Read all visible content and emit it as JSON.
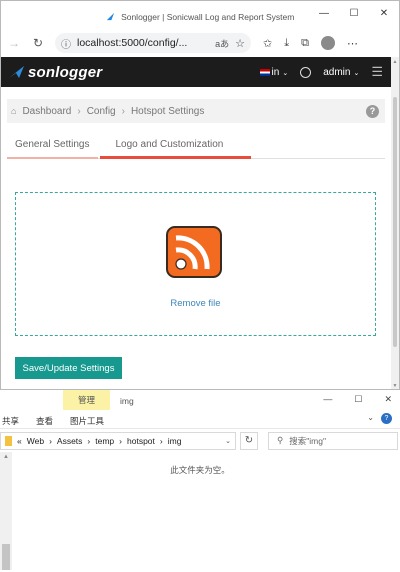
{
  "browser": {
    "title": "Sonlogger | Sonicwall Log and Report System",
    "url": "localhost:5000/config/...",
    "reader_label": "aあ"
  },
  "app": {
    "brand": "sonlogger",
    "language": "in",
    "user": "admin"
  },
  "breadcrumb": {
    "items": [
      "Dashboard",
      "Config",
      "Hotspot Settings"
    ],
    "help": "?"
  },
  "tabs": {
    "general": "General Settings",
    "logo": "Logo and Customization"
  },
  "dropzone": {
    "remove_label": "Remove file"
  },
  "save_button": "Save/Update Settings",
  "explorer": {
    "tools_tab": "管理",
    "folder": "img",
    "ribbon_tabs": [
      "共享",
      "查看",
      "图片工具"
    ],
    "path": [
      "«",
      "Web",
      "Assets",
      "temp",
      "hotspot",
      "img"
    ],
    "search_placeholder": "搜索\"img\"",
    "empty_message": "此文件夹为空。"
  },
  "colors": {
    "accent": "#17998f",
    "tab_active": "#e74c3c",
    "link": "#3e86b9",
    "rss": "#f26b21"
  }
}
